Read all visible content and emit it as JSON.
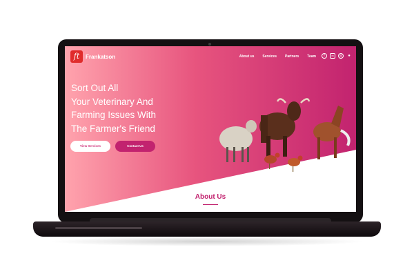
{
  "site": {
    "logo_mark": "ft",
    "brand": "Frankatson"
  },
  "nav": {
    "items": [
      {
        "label": "About us"
      },
      {
        "label": "Services"
      },
      {
        "label": "Partners"
      },
      {
        "label": "Team"
      }
    ],
    "socials": [
      {
        "icon": "facebook-icon",
        "glyph": "f"
      },
      {
        "icon": "linkedin-icon",
        "glyph": "in"
      },
      {
        "icon": "instagram-icon",
        "glyph": "◎"
      },
      {
        "icon": "user-icon",
        "glyph": "●"
      }
    ]
  },
  "hero": {
    "lines": [
      "Sort Out All",
      "Your Veterinary And",
      "Farming Issues With",
      "The Farmer's Friend"
    ],
    "view_services": "View Services",
    "contact_us": "Contact Us"
  },
  "section": {
    "about_title": "About Us"
  },
  "colors": {
    "accent": "#c2236f",
    "gradient_start": "#ffa3ad",
    "gradient_end": "#c2236f",
    "logo_red": "#e02c2c"
  }
}
